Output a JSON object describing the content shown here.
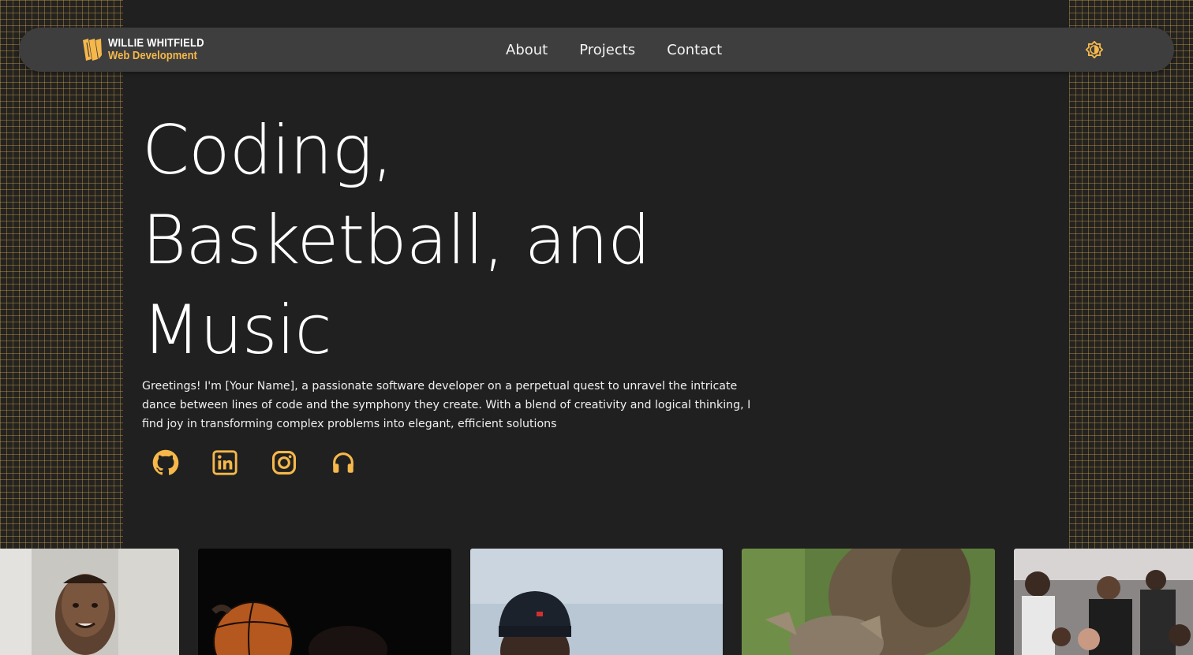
{
  "brand": {
    "name": "WILLIE WHITFIELD",
    "subtitle": "Web Development",
    "accent_color": "#f6b84a",
    "logo_icon": "ww-logo-mark"
  },
  "nav": {
    "links": [
      {
        "label": "About"
      },
      {
        "label": "Projects"
      },
      {
        "label": "Contact"
      }
    ],
    "theme_toggle_icon": "brightness-icon"
  },
  "hero": {
    "title_lines": [
      "Coding,",
      "Basketball, and",
      "Music"
    ],
    "intro": "Greetings! I'm [Your Name], a passionate software developer on a perpetual quest to unravel the intricate dance between lines of code and the symphony they create. With a blend of creativity and logical thinking, I find joy in transforming complex problems into elegant, efficient solutions"
  },
  "socials": [
    {
      "name": "github",
      "icon": "github-icon"
    },
    {
      "name": "linkedin",
      "icon": "linkedin-icon"
    },
    {
      "name": "instagram",
      "icon": "instagram-icon"
    },
    {
      "name": "music",
      "icon": "headphones-icon"
    }
  ],
  "photos": [
    {
      "subject": "child-portrait"
    },
    {
      "subject": "basketball"
    },
    {
      "subject": "man-in-beanie"
    },
    {
      "subject": "cat"
    },
    {
      "subject": "crowd"
    }
  ],
  "colors": {
    "background": "#202020",
    "navbar": "#3e3e3e",
    "grid_line": "#d6aa50",
    "text": "#ffffff"
  }
}
